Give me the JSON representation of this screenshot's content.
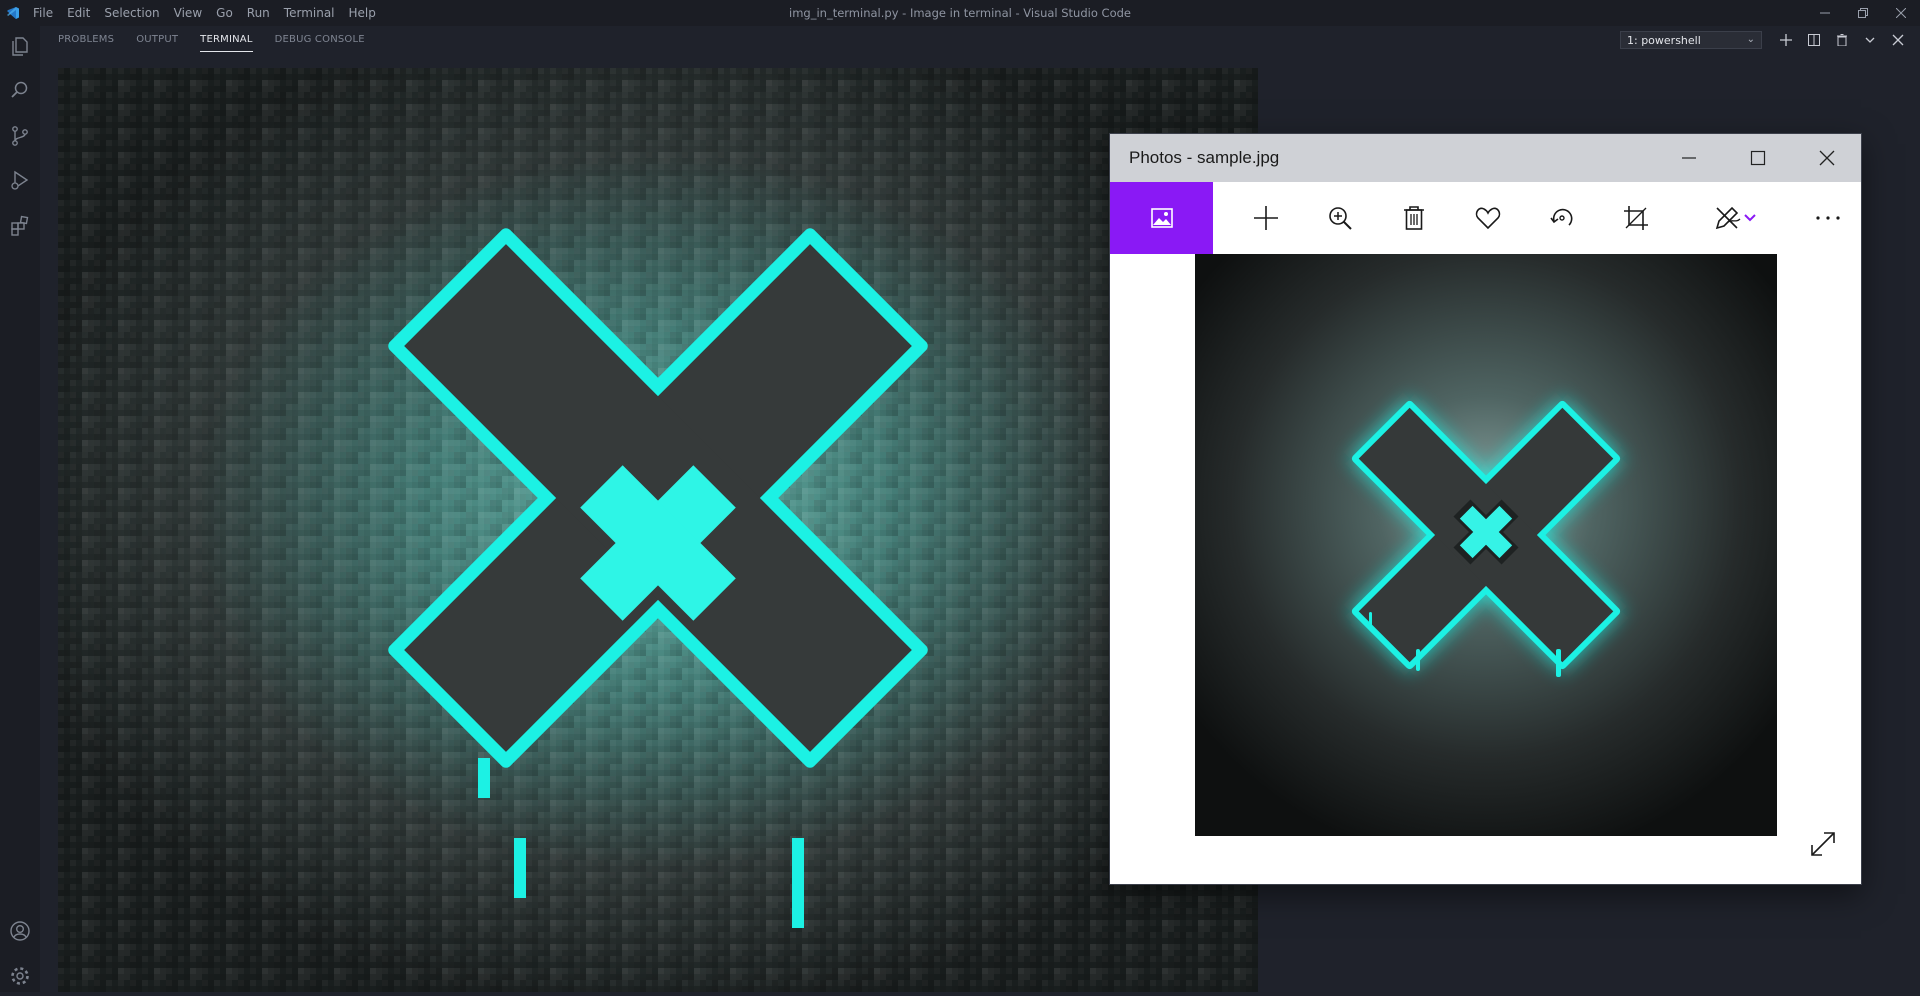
{
  "window": {
    "title": "img_in_terminal.py - Image in terminal - Visual Studio Code",
    "menu": [
      "File",
      "Edit",
      "Selection",
      "View",
      "Go",
      "Run",
      "Terminal",
      "Help"
    ]
  },
  "activity_bar": {
    "icons": [
      "explorer-icon",
      "search-icon",
      "source-control-icon",
      "run-debug-icon",
      "extensions-icon",
      "account-icon",
      "settings-gear-icon"
    ]
  },
  "panel": {
    "tabs": [
      {
        "label": "PROBLEMS",
        "active": false
      },
      {
        "label": "OUTPUT",
        "active": false
      },
      {
        "label": "TERMINAL",
        "active": true
      },
      {
        "label": "DEBUG CONSOLE",
        "active": false
      }
    ],
    "terminal_select": "1: powershell",
    "actions": [
      "add-terminal-icon",
      "split-terminal-icon",
      "kill-terminal-icon",
      "chevron-down-icon",
      "close-icon"
    ]
  },
  "photos": {
    "title": "Photos - sample.jpg",
    "toolbar": [
      "view-image-icon",
      "add-icon",
      "zoom-icon",
      "delete-icon",
      "favorite-icon",
      "rotate-icon",
      "crop-icon",
      "edit-draw-icon",
      "more-icon"
    ]
  },
  "colors": {
    "accent_purple": "#8a19f5",
    "neon_cyan": "#1cf1e4",
    "editor_bg": "#1f222b"
  }
}
